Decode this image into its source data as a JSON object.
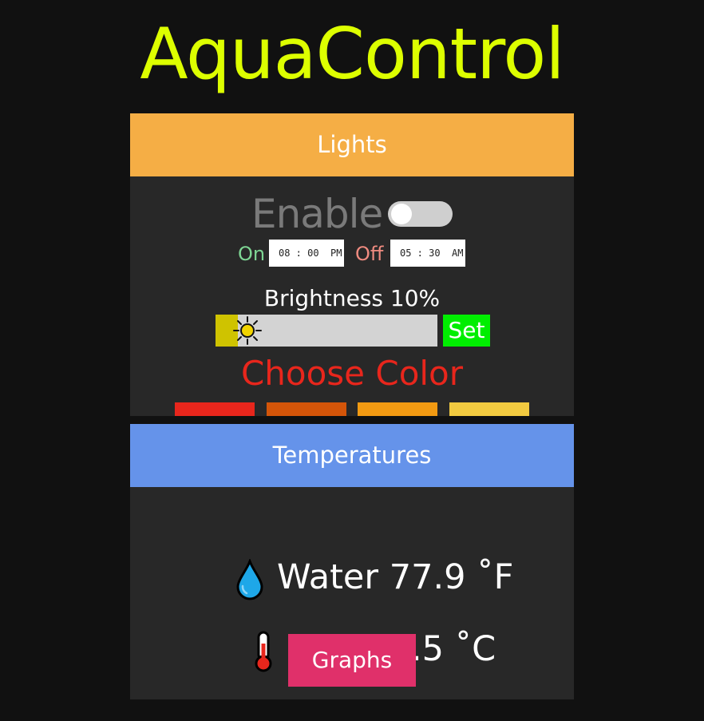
{
  "app": {
    "title": "AquaControl"
  },
  "lights": {
    "header": "Lights",
    "enable_label": "Enable",
    "enabled": false,
    "on_label": "On",
    "on_time": "08 : 00  PM",
    "off_label": "Off",
    "off_time": "05 : 30  AM",
    "brightness_label": "Brightness 10%",
    "brightness_percent": 10,
    "set_label": "Set",
    "choose_color_label": "Choose Color",
    "swatches": [
      "#E8261C",
      "#D45509",
      "#F29A12",
      "#F2CA40"
    ]
  },
  "temperatures": {
    "header": "Temperatures",
    "water": "Water 77.9 ˚F",
    "cpu": "CPU 43.5 ˚C",
    "graphs_label": "Graphs"
  },
  "icons": {
    "water": "water-drop-icon",
    "cpu": "thermometer-icon",
    "brightness": "sun-icon"
  },
  "colors": {
    "title": "#DDFF00",
    "lights_header": "#F5AE45",
    "temps_header": "#6593EA",
    "set_button": "#00EE00",
    "graphs_button": "#E0306A",
    "choose_color": "#E8261C",
    "on_label": "#7ED694",
    "off_label": "#F08B80"
  }
}
